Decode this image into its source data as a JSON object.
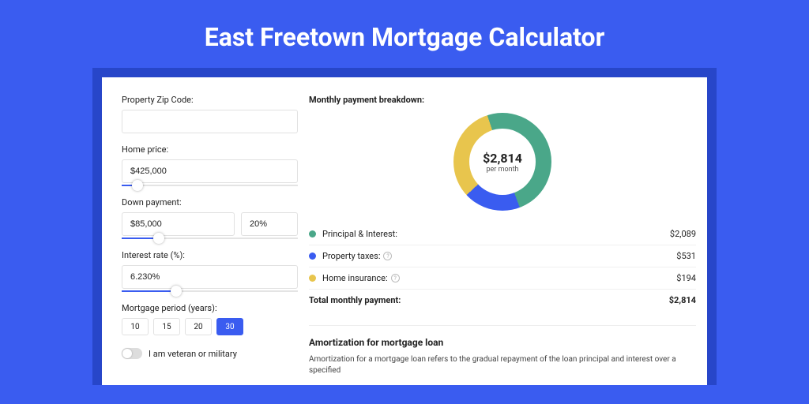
{
  "title": "East Freetown Mortgage Calculator",
  "form": {
    "zip_label": "Property Zip Code:",
    "zip_value": "",
    "home_price_label": "Home price:",
    "home_price_value": "$425,000",
    "down_payment_label": "Down payment:",
    "down_payment_value": "$85,000",
    "down_payment_pct": "20%",
    "interest_label": "Interest rate (%):",
    "interest_value": "6.230%",
    "period_label": "Mortgage period (years):",
    "periods": [
      "10",
      "15",
      "20",
      "30"
    ],
    "period_active": "30",
    "veteran_label": "I am veteran or military"
  },
  "breakdown": {
    "title": "Monthly payment breakdown:",
    "center_value": "$2,814",
    "center_label": "per month",
    "items": [
      {
        "label": "Principal & Interest:",
        "value": "$2,089",
        "color": "#4aa789",
        "info": false
      },
      {
        "label": "Property taxes:",
        "value": "$531",
        "color": "#3a5cf0",
        "info": true
      },
      {
        "label": "Home insurance:",
        "value": "$194",
        "color": "#e8c54d",
        "info": true
      }
    ],
    "total_label": "Total monthly payment:",
    "total_value": "$2,814"
  },
  "amortization": {
    "title": "Amortization for mortgage loan",
    "body": "Amortization for a mortgage loan refers to the gradual repayment of the loan principal and interest over a specified"
  },
  "chart_data": {
    "type": "pie",
    "title": "Monthly payment breakdown",
    "series": [
      {
        "name": "Principal & Interest",
        "value": 2089,
        "color": "#4aa789"
      },
      {
        "name": "Property taxes",
        "value": 531,
        "color": "#3a5cf0"
      },
      {
        "name": "Home insurance",
        "value": 194,
        "color": "#e8c54d"
      }
    ],
    "total": 2814,
    "center_label": "per month"
  }
}
